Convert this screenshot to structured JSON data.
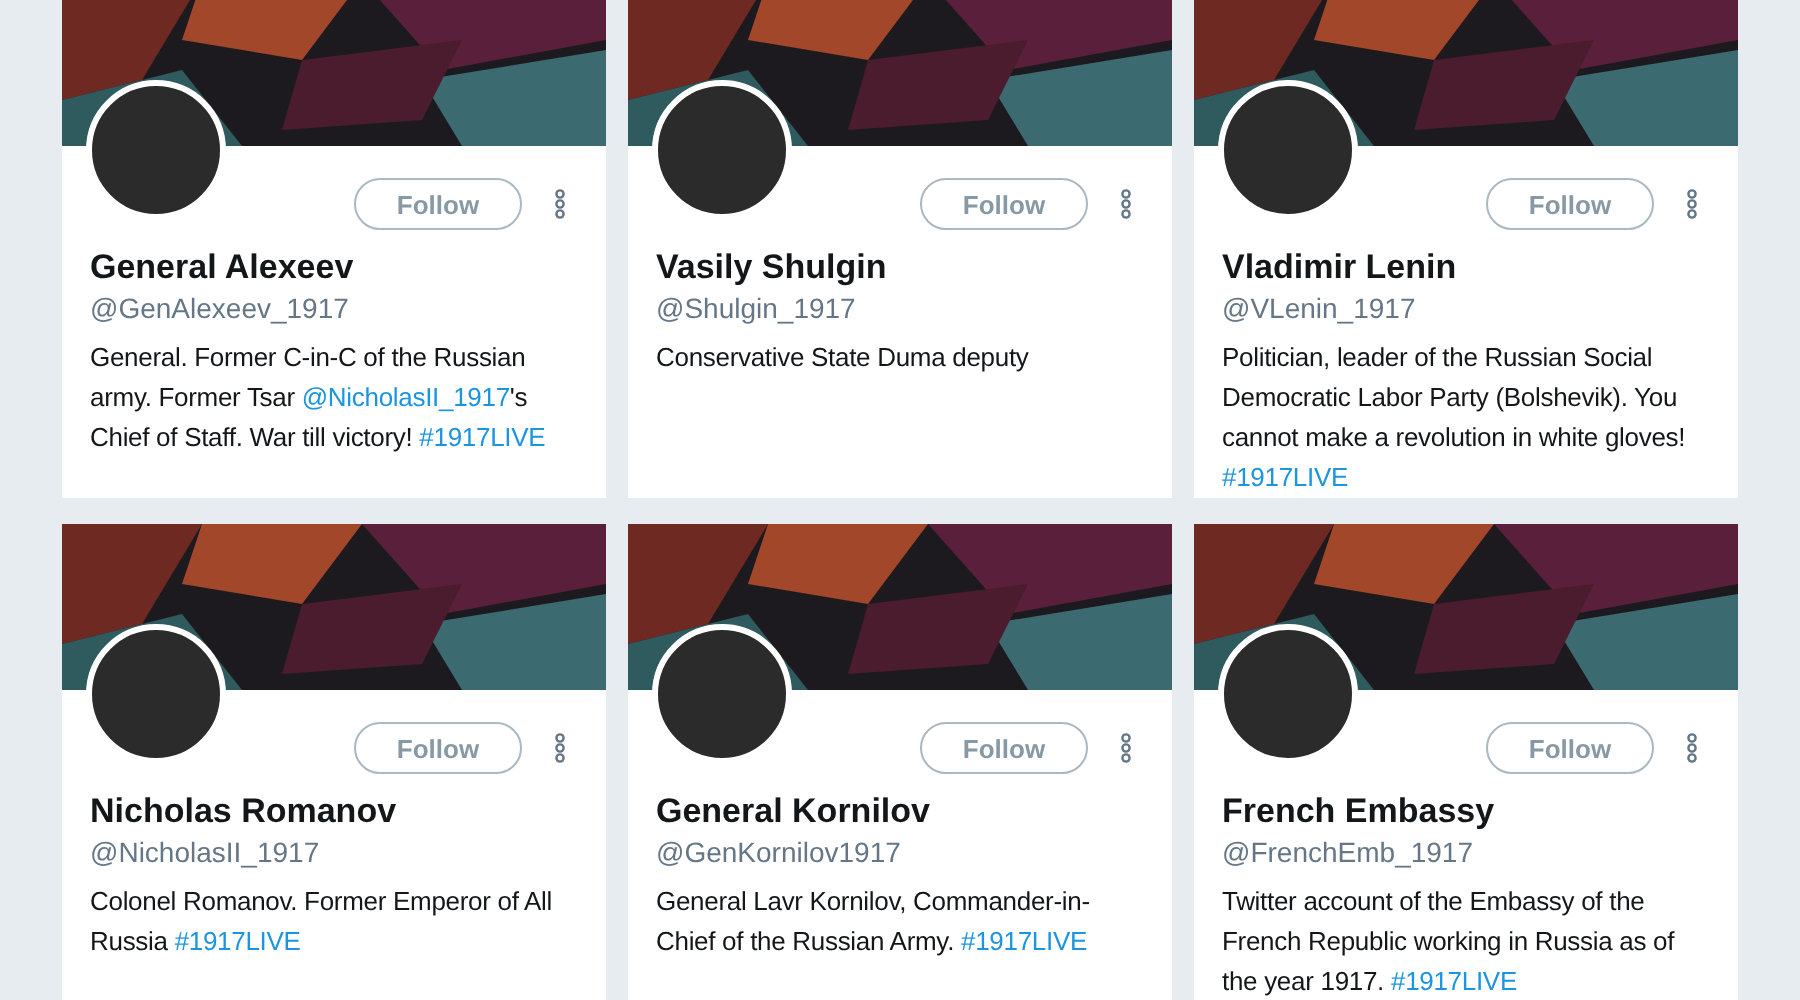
{
  "profiles": [
    {
      "name": "General Alexeev",
      "handle": "@GenAlexeev_1917",
      "follow_label": "Follow",
      "bio": [
        {
          "kind": "text",
          "text": "General. Former C-in-C of the Russian army. Former Tsar "
        },
        {
          "kind": "mention",
          "text": "@NicholasII_1917"
        },
        {
          "kind": "text",
          "text": "'s Chief of Staff. War till victory! "
        },
        {
          "kind": "hashtag",
          "text": "#1917LIVE"
        }
      ]
    },
    {
      "name": "Vasily Shulgin",
      "handle": "@Shulgin_1917",
      "follow_label": "Follow",
      "bio": [
        {
          "kind": "text",
          "text": "Conservative State Duma deputy"
        }
      ]
    },
    {
      "name": "Vladimir Lenin",
      "handle": "@VLenin_1917",
      "follow_label": "Follow",
      "bio": [
        {
          "kind": "text",
          "text": "Politician, leader of the Russian Social Democratic Labor Party (Bolshevik). You cannot make a revolution in white gloves! "
        },
        {
          "kind": "hashtag",
          "text": "#1917LIVE"
        }
      ]
    },
    {
      "name": "Nicholas Romanov",
      "handle": "@NicholasII_1917",
      "follow_label": "Follow",
      "bio": [
        {
          "kind": "text",
          "text": "Colonel Romanov. Former Emperor of All Russia "
        },
        {
          "kind": "hashtag",
          "text": "#1917LIVE"
        }
      ]
    },
    {
      "name": "General Kornilov",
      "handle": "@GenKornilov1917",
      "follow_label": "Follow",
      "bio": [
        {
          "kind": "text",
          "text": "General Lavr Kornilov, Commander-in-Chief of the Russian Army. "
        },
        {
          "kind": "hashtag",
          "text": "#1917LIVE"
        }
      ]
    },
    {
      "name": "French Embassy",
      "handle": "@FrenchEmb_1917",
      "follow_label": "Follow",
      "bio": [
        {
          "kind": "text",
          "text": "Twitter account of the Embassy of the French Republic working in Russia as of the year 1917. "
        },
        {
          "kind": "hashtag",
          "text": "#1917LIVE"
        }
      ]
    }
  ]
}
